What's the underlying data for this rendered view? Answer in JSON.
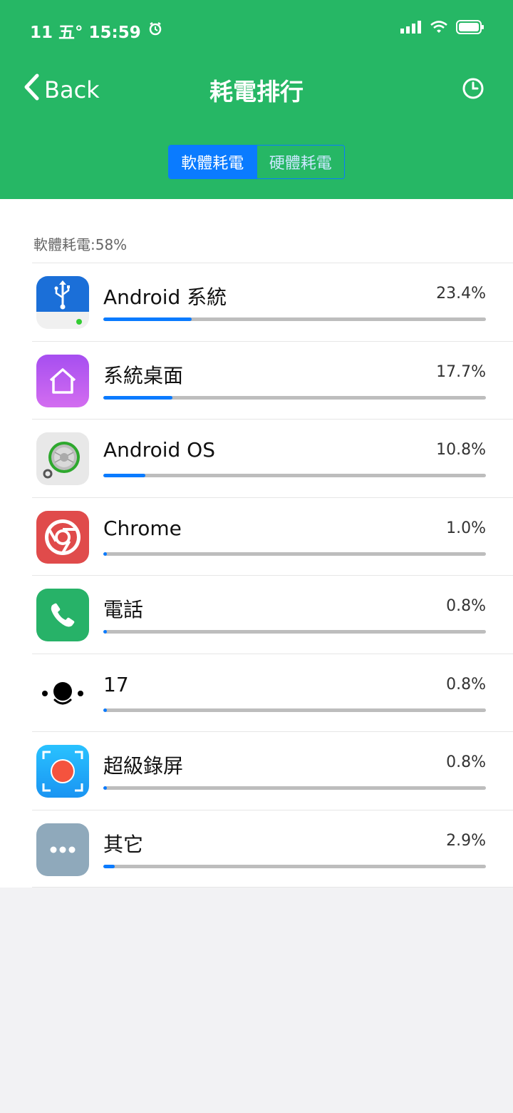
{
  "status_bar": {
    "left_text": "11 五° 15:59",
    "icons": [
      "alarm-icon",
      "signal-icon",
      "wifi-icon",
      "battery-icon"
    ]
  },
  "nav": {
    "back_label": "Back",
    "title": "耗電排行",
    "right_icon": "history-clock-icon"
  },
  "segment": {
    "active_label": "軟體耗電",
    "inactive_label": "硬體耗電"
  },
  "section": {
    "label": "軟體耗電:58%"
  },
  "apps": [
    {
      "name": "Android 系統",
      "percent": "23.4%",
      "fill_ratio": 0.23,
      "icon": "usb-system-icon"
    },
    {
      "name": "系統桌面",
      "percent": "17.7%",
      "fill_ratio": 0.18,
      "icon": "home-launcher-icon"
    },
    {
      "name": "Android OS",
      "percent": "10.8%",
      "fill_ratio": 0.11,
      "icon": "android-os-icon"
    },
    {
      "name": "Chrome",
      "percent": "1.0%",
      "fill_ratio": 0.01,
      "icon": "chrome-icon"
    },
    {
      "name": "電話",
      "percent": "0.8%",
      "fill_ratio": 0.008,
      "icon": "phone-icon"
    },
    {
      "name": "17",
      "percent": "0.8%",
      "fill_ratio": 0.008,
      "icon": "app-17-icon"
    },
    {
      "name": "超級錄屏",
      "percent": "0.8%",
      "fill_ratio": 0.008,
      "icon": "screen-record-icon"
    },
    {
      "name": "其它",
      "percent": "2.9%",
      "fill_ratio": 0.03,
      "icon": "more-icon"
    }
  ],
  "colors": {
    "header": "#26b765",
    "accent": "#0a7bff",
    "track": "#bdbdbd"
  }
}
